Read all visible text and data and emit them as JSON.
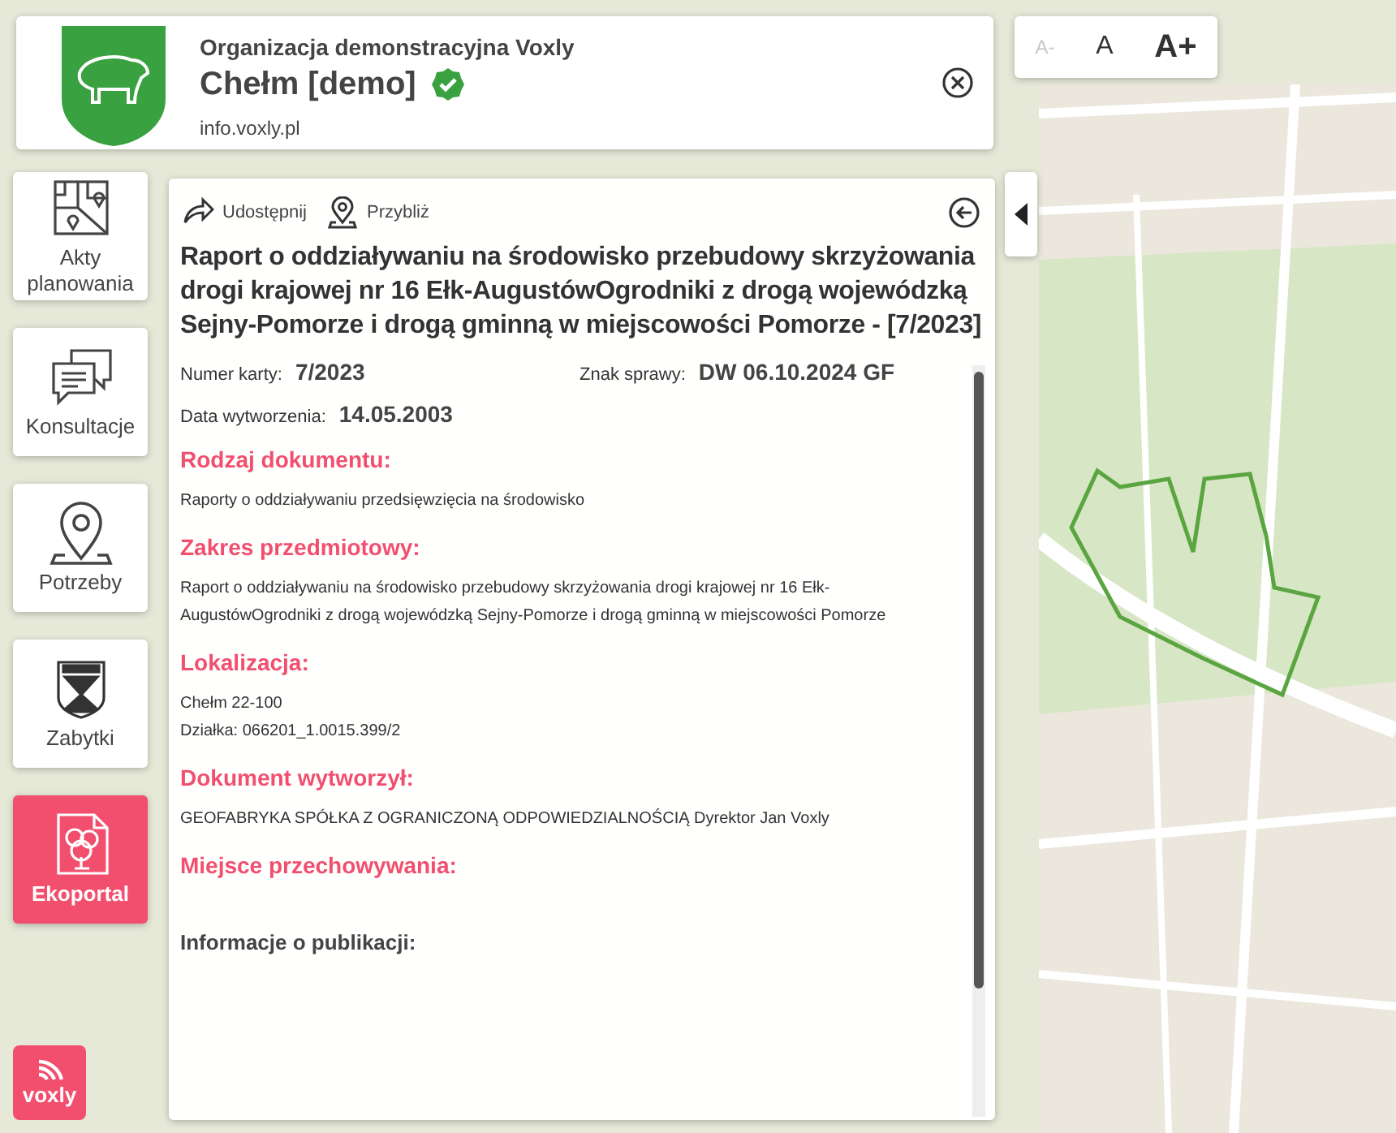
{
  "header": {
    "organization": "Organizacja demonstracyjna Voxly",
    "title": "Chełm [demo]",
    "verified": true,
    "url": "info.voxly.pl"
  },
  "font_controls": [
    {
      "label": "A-",
      "disabled": true
    },
    {
      "label": "A",
      "disabled": false
    },
    {
      "label": "A+",
      "disabled": false
    }
  ],
  "nav": {
    "items": [
      {
        "label": "Akty planowania",
        "kind": "map",
        "selected": false
      },
      {
        "label": "Konsultacje",
        "kind": "chat",
        "selected": false
      },
      {
        "label": "Potrzeby",
        "kind": "pin",
        "selected": false
      },
      {
        "label": "Zabytki",
        "kind": "shield",
        "selected": false
      },
      {
        "label": "Ekoportal",
        "kind": "tree",
        "selected": true
      }
    ]
  },
  "brand": {
    "label": "voxly"
  },
  "panel": {
    "actions": [
      {
        "label": "Udostępnij",
        "kind": "share"
      },
      {
        "label": "Przybliż",
        "kind": "pin"
      }
    ],
    "title": "Raport o oddziaływaniu na środowisko przebudowy skrzyżowania drogi krajowej nr 16 Ełk-AugustówOgrodniki z drogą wojewódzką Sejny-Pomorze i drogą gminną w miejscowości Pomorze - [7/2023]",
    "fields": [
      {
        "label": "Numer karty:",
        "value": "7/2023"
      },
      {
        "label": "Znak sprawy:",
        "value": "DW 06.10.2024 GF"
      },
      {
        "label": "Data wytworzenia:",
        "value": "14.05.2003"
      }
    ],
    "sections": [
      {
        "kind": "accent",
        "heading": "Rodzaj dokumentu:",
        "lines": [
          "Raporty o oddziaływaniu przedsięwzięcia na środowisko"
        ]
      },
      {
        "kind": "accent",
        "heading": "Zakres przedmiotowy:",
        "lines": [
          "Raport o oddziaływaniu na środowisko przebudowy skrzyżowania drogi krajowej nr 16 Ełk-AugustówOgrodniki z drogą wojewódzką Sejny-Pomorze i drogą gminną w miejscowości Pomorze"
        ]
      },
      {
        "kind": "accent",
        "heading": "Lokalizacja:",
        "lines": [
          "Chełm 22-100",
          "Działka: 066201_1.0015.399/2"
        ]
      },
      {
        "kind": "accent",
        "heading": "Dokument wytworzył:",
        "lines": [
          "GEOFABRYKA SPÓŁKA Z OGRANICZONĄ ODPOWIEDZIALNOŚCIĄ Dyrektor Jan Voxly"
        ]
      },
      {
        "kind": "accent",
        "heading": "Miejsce przechowywania:"
      },
      {
        "kind": "plain",
        "heading": "Informacje o publikacji:"
      }
    ]
  }
}
